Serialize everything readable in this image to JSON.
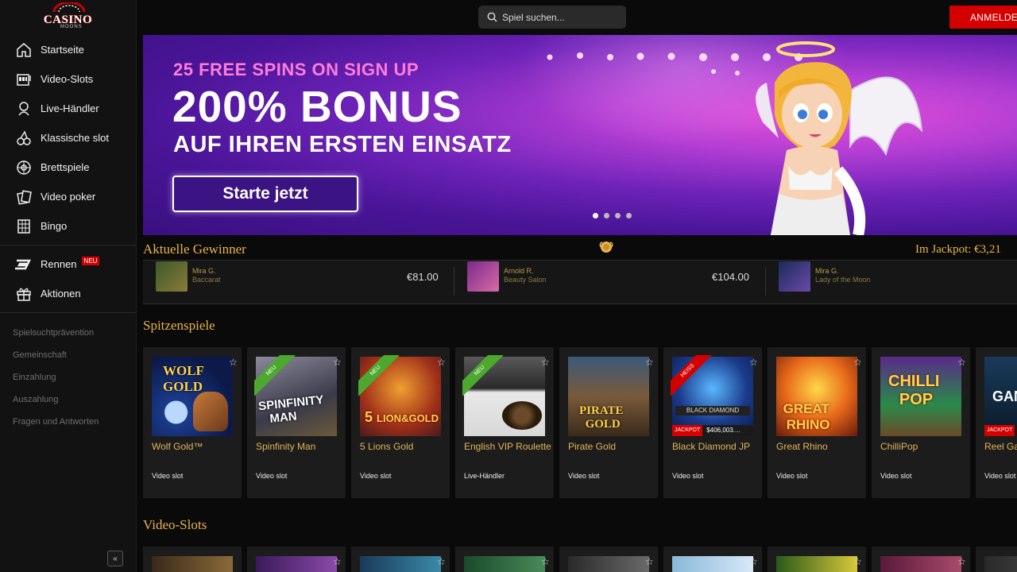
{
  "brand": {
    "logo_text": "CASINO",
    "logo_sub": "MOONS"
  },
  "search": {
    "placeholder": "Spiel suchen..."
  },
  "header": {
    "login_label": "ANMELDEN"
  },
  "sidebar": {
    "items": [
      {
        "label": "Startseite",
        "icon": "home-icon"
      },
      {
        "label": "Video-Slots",
        "icon": "slot-machine-icon"
      },
      {
        "label": "Live-Händler",
        "icon": "live-dealer-icon"
      },
      {
        "label": "Klassische slot",
        "icon": "cherry-icon"
      },
      {
        "label": "Brettspiele",
        "icon": "roulette-icon"
      },
      {
        "label": "Video poker",
        "icon": "cards-icon"
      },
      {
        "label": "Bingo",
        "icon": "bingo-icon"
      }
    ],
    "extra": [
      {
        "label": "Rennen",
        "badge": "NEU",
        "icon": "racing-icon"
      },
      {
        "label": "Aktionen",
        "icon": "gift-icon"
      }
    ],
    "links": [
      "Spielsuchtprävention",
      "Gemeinschaft",
      "Einzahlung",
      "Auszahlung",
      "Fragen und Antworten"
    ],
    "collapse_label": "«"
  },
  "banner": {
    "subtitle": "25 FREE SPINS ON SIGN UP",
    "title": "200% BONUS",
    "title2": "AUF IHREN ERSTEN EINSATZ",
    "cta": "Starte jetzt",
    "slides": 4,
    "active_slide": 1
  },
  "winners": {
    "title": "Aktuelle Gewinner",
    "jackpot_label": "Im Jackpot: €3,21",
    "list": [
      {
        "name": "Mira G.",
        "game": "Baccarat",
        "amount": "€81.00"
      },
      {
        "name": "Arnold R.",
        "game": "Beauty Salon",
        "amount": "€104.00"
      },
      {
        "name": "Mira G.",
        "game": "Lady of the Moon",
        "amount": ""
      }
    ]
  },
  "top_games": {
    "title": "Spitzenspiele",
    "cards": [
      {
        "title": "Wolf Gold™",
        "category": "Video slot",
        "ribbon": ""
      },
      {
        "title": "Spinfinity Man",
        "category": "Video slot",
        "ribbon": "NEU"
      },
      {
        "title": "5 Lions Gold",
        "category": "Video slot",
        "ribbon": "NEU"
      },
      {
        "title": "English VIP Roulette",
        "category": "Live-Händler",
        "ribbon": "NEU"
      },
      {
        "title": "Pirate Gold",
        "category": "Video slot",
        "ribbon": ""
      },
      {
        "title": "Black Diamond JP",
        "category": "Video slot",
        "ribbon": "HEISS",
        "jackpot_tag": "JACKPOT",
        "jackpot_value": "$406,003...."
      },
      {
        "title": "Great Rhino",
        "category": "Video slot",
        "ribbon": ""
      },
      {
        "title": "ChilliPop",
        "category": "Video slot",
        "ribbon": ""
      },
      {
        "title": "Reel Ga",
        "category": "Video slot",
        "ribbon": "",
        "jackpot_tag": "JACKPOT"
      }
    ]
  },
  "video_slots": {
    "title": "Video-Slots"
  },
  "colors": {
    "accent": "#e8b548",
    "brand_red": "#d40000",
    "new_green": "#4ca82e",
    "banner_purple": "#5a1ca8"
  }
}
